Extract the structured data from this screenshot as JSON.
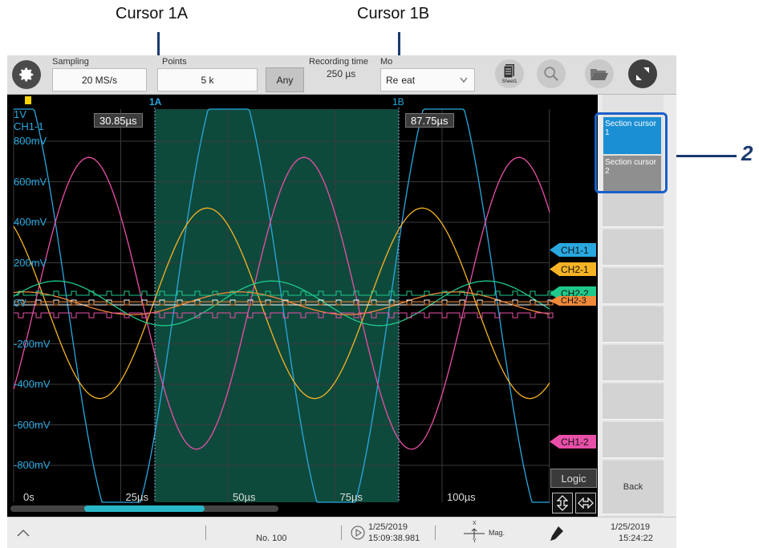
{
  "callouts": {
    "cursor_1a": "Cursor 1A",
    "cursor_1b": "Cursor 1B",
    "number": "2"
  },
  "toolbar": {
    "sampling_label": "Sampling",
    "sampling_value": "20 MS/s",
    "points_label": "Points",
    "points_value": "5 k",
    "any_label": "Any",
    "recording_time_label": "Recording time",
    "recording_time_value": "250 µs",
    "mode_label": "Mo",
    "mode_value": "Re",
    "mode_value_2": "eat",
    "sheet_label": "Sheet1"
  },
  "waveform": {
    "marker_1a": "1A",
    "marker_1b": "1B",
    "cursor_a_time": "30.85µs",
    "cursor_b_time": "87.75µs",
    "scale_1v": "1V",
    "channel_label": "CH1-1",
    "y_ticks": [
      "800mV",
      "600mV",
      "400mV",
      "200mV",
      "0V",
      "-200mV",
      "-400mV",
      "-600mV",
      "-800mV"
    ],
    "x_ticks": [
      "0s",
      "25µs",
      "50µs",
      "75µs",
      "100µs"
    ],
    "channel_tags": [
      {
        "label": "CH1-1",
        "color": "#29a8e0"
      },
      {
        "label": "CH2-1",
        "color": "#f5b325"
      },
      {
        "label": "CH2-2",
        "color": "#1fc98a"
      },
      {
        "label": "CH2-3",
        "color": "#f08a3a"
      },
      {
        "label": "CH1-2",
        "color": "#e84fa8"
      }
    ],
    "logic_label": "Logic"
  },
  "right_panel": {
    "section_cursor_1": "Section cursor 1",
    "section_cursor_2": "Section cursor 2",
    "back_label": "Back"
  },
  "status_bar": {
    "file_no": "No. 100",
    "trigger_date": "1/25/2019",
    "trigger_time": "15:09:38.981",
    "mag_label": "Mag.",
    "mag_x": "X",
    "mag_y": "Y",
    "clock_date": "1/25/2019",
    "clock_time": "15:24:22"
  },
  "colors": {
    "ch1_1": "#29a8e0",
    "ch1_2": "#e84fa8",
    "ch2_1": "#f5b325",
    "ch2_2": "#1fc98a",
    "ch2_3": "#f08a3a",
    "section_fill": "#0e4a3c",
    "callout": "#1a3a6e",
    "active_button": "#1b8fd4"
  }
}
